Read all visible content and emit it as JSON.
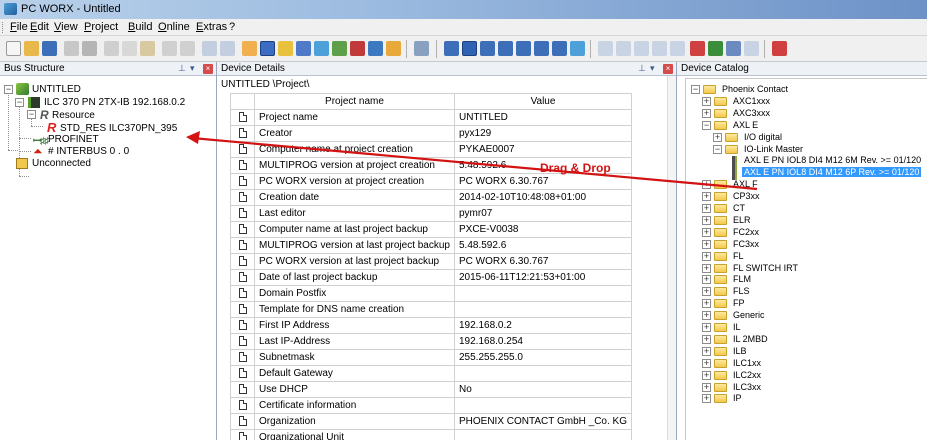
{
  "window": {
    "title": "PC WORX - Untitled"
  },
  "menu": [
    "File",
    "Edit",
    "View",
    "Project",
    "Build",
    "Online",
    "Extras",
    "?"
  ],
  "bus_structure": {
    "panel_title": "Bus Structure",
    "nodes": [
      {
        "label": "UNTITLED"
      },
      {
        "label": "ILC 370 PN 2TX-IB 192.168.0.2"
      },
      {
        "label": "Resource"
      },
      {
        "label": "STD_RES ILC370PN_395"
      },
      {
        "label": "PROFINET"
      },
      {
        "label": "# INTERBUS 0 . 0"
      },
      {
        "label": "Unconnected"
      }
    ]
  },
  "device_details": {
    "panel_title": "Device Details",
    "path": "UNTITLED \\Project\\",
    "columns": [
      "Project name",
      "Value"
    ],
    "rows": [
      [
        "Project name",
        "UNTITLED"
      ],
      [
        "Creator",
        "pyx129"
      ],
      [
        "Computer name at project creation",
        "PYKAE0007"
      ],
      [
        "MULTIPROG version at project creation",
        "5.48.592.6"
      ],
      [
        "PC WORX version at project creation",
        "PC WORX 6.30.767"
      ],
      [
        "Creation date",
        "2014-02-10T10:48:08+01:00"
      ],
      [
        "Last editor",
        "pymr07"
      ],
      [
        "Computer name at last project backup",
        "PXCE-V0038"
      ],
      [
        "MULTIPROG version at last project backup",
        "5.48.592.6"
      ],
      [
        "PC WORX version at last project backup",
        "PC WORX 6.30.767"
      ],
      [
        "Date of last project backup",
        "2015-06-11T12:21:53+01:00"
      ],
      [
        "Domain Postfix",
        ""
      ],
      [
        "Template for DNS name creation",
        ""
      ],
      [
        "First IP Address",
        "192.168.0.2"
      ],
      [
        "Last IP-Address",
        "192.168.0.254"
      ],
      [
        "Subnetmask",
        "255.255.255.0"
      ],
      [
        "Default Gateway",
        ""
      ],
      [
        "Use DHCP",
        "No"
      ],
      [
        "Certificate information",
        ""
      ],
      [
        "Organization",
        "PHOENIX CONTACT GmbH _Co. KG"
      ],
      [
        "Organizational Unit",
        ""
      ]
    ]
  },
  "device_catalog": {
    "panel_title": "Device Catalog",
    "items": [
      {
        "label": "Phoenix Contact"
      },
      {
        "label": "AXC1xxx"
      },
      {
        "label": "AXC3xxx"
      },
      {
        "label": "AXL E"
      },
      {
        "label": "I/O digital"
      },
      {
        "label": "IO-Link Master"
      },
      {
        "label": "AXL E PN IOL8 DI4 M12 6M Rev. >= 01/120"
      },
      {
        "label": "AXL E PN IOL8 DI4 M12 6P Rev. >= 01/120"
      },
      {
        "label": "AXL F"
      },
      {
        "label": "CP3xx"
      },
      {
        "label": "CT"
      },
      {
        "label": "ELR"
      },
      {
        "label": "FC2xx"
      },
      {
        "label": "FC3xx"
      },
      {
        "label": "FL"
      },
      {
        "label": "FL SWITCH IRT"
      },
      {
        "label": "FLM"
      },
      {
        "label": "FLS"
      },
      {
        "label": "FP"
      },
      {
        "label": "Generic"
      },
      {
        "label": "IL"
      },
      {
        "label": "IL 2MBD"
      },
      {
        "label": "ILB"
      },
      {
        "label": "ILC1xx"
      },
      {
        "label": "ILC2xx"
      },
      {
        "label": "ILC3xx"
      },
      {
        "label": "IP"
      }
    ]
  },
  "annotation": {
    "label": "Drag & Drop",
    "color": "#d31212"
  }
}
